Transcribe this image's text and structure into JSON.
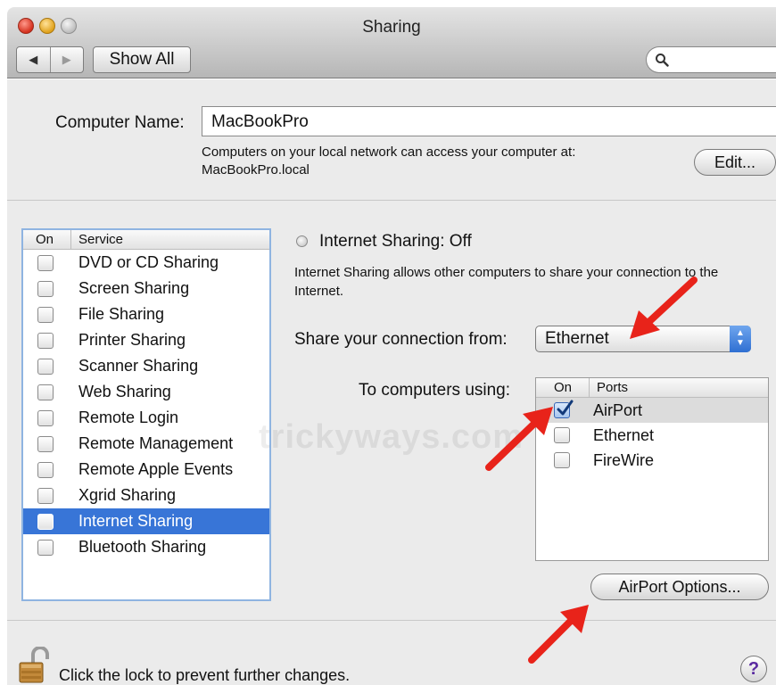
{
  "window": {
    "title": "Sharing",
    "show_all_label": "Show All",
    "back_glyph": "◀",
    "forward_glyph": "▶",
    "search_placeholder": ""
  },
  "computer_name": {
    "label": "Computer Name:",
    "value": "MacBookPro",
    "note_line1": "Computers on your local network can access your computer at:",
    "note_line2": "MacBookPro.local",
    "edit_label": "Edit..."
  },
  "services": {
    "header_on": "On",
    "header_service": "Service",
    "items": [
      {
        "label": "DVD or CD Sharing",
        "checked": false,
        "selected": false
      },
      {
        "label": "Screen Sharing",
        "checked": false,
        "selected": false
      },
      {
        "label": "File Sharing",
        "checked": false,
        "selected": false
      },
      {
        "label": "Printer Sharing",
        "checked": false,
        "selected": false
      },
      {
        "label": "Scanner Sharing",
        "checked": false,
        "selected": false
      },
      {
        "label": "Web Sharing",
        "checked": false,
        "selected": false
      },
      {
        "label": "Remote Login",
        "checked": false,
        "selected": false
      },
      {
        "label": "Remote Management",
        "checked": false,
        "selected": false
      },
      {
        "label": "Remote Apple Events",
        "checked": false,
        "selected": false
      },
      {
        "label": "Xgrid Sharing",
        "checked": false,
        "selected": false
      },
      {
        "label": "Internet Sharing",
        "checked": false,
        "selected": true
      },
      {
        "label": "Bluetooth Sharing",
        "checked": false,
        "selected": false
      }
    ]
  },
  "internet_sharing": {
    "status": "Internet Sharing: Off",
    "desc_line1": "Internet Sharing allows other computers to share your connection to the",
    "desc_line2": "Internet.",
    "share_from_label": "Share your connection from:",
    "share_from_value": "Ethernet",
    "to_computers_label": "To computers using:",
    "ports_header_on": "On",
    "ports_header_ports": "Ports",
    "ports": [
      {
        "label": "AirPort",
        "checked": true,
        "highlighted": true
      },
      {
        "label": "Ethernet",
        "checked": false,
        "highlighted": false
      },
      {
        "label": "FireWire",
        "checked": false,
        "highlighted": false
      }
    ],
    "options_label": "AirPort Options..."
  },
  "footer": {
    "lock_text": "Click the lock to prevent further changes.",
    "help_glyph": "?"
  },
  "watermark": "trickyways.com",
  "colors": {
    "selection": "#3875d7",
    "annotation_arrow": "#e8231a",
    "list_focus_ring": "#8fb4e1"
  }
}
